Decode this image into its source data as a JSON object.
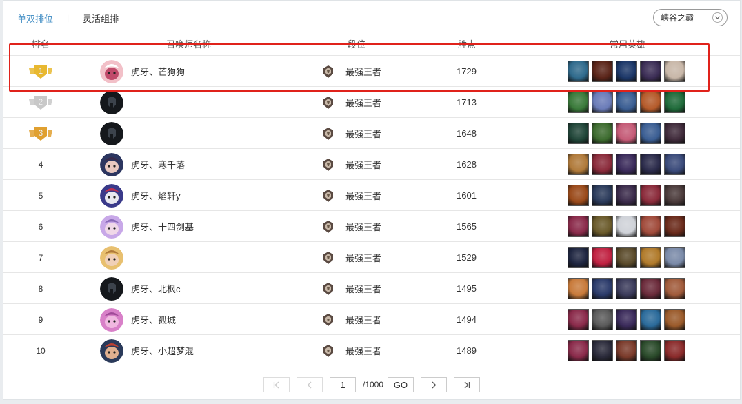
{
  "tabs": [
    {
      "label": "单双排位",
      "active": true
    },
    {
      "label": "灵活组排",
      "active": false
    }
  ],
  "region_select": {
    "value": "峡谷之巅"
  },
  "table": {
    "headers": {
      "rank": "排名",
      "name": "召唤师名称",
      "tier": "段位",
      "lp": "胜点",
      "heroes": "常用英雄"
    },
    "rows": [
      {
        "rank": "1",
        "medal": "gold",
        "name": "虎牙、芒狗狗",
        "avatar": "dog",
        "tier": "最强王者",
        "lp": "1729",
        "heroes": [
          "#2f6a8c",
          "#5a2418",
          "#1c3768",
          "#3b2d55",
          "#c8b7a8"
        ]
      },
      {
        "rank": "2",
        "medal": "silver",
        "name": "",
        "avatar": "dark",
        "tier": "最强王者",
        "lp": "1713",
        "heroes": [
          "#3a7a3a",
          "#6a7bb8",
          "#3a5d92",
          "#b45a2a",
          "#1f6b3a"
        ]
      },
      {
        "rank": "3",
        "medal": "bronze",
        "name": "",
        "avatar": "dark",
        "tier": "最强王者",
        "lp": "1648",
        "heroes": [
          "#204538",
          "#3c6b2e",
          "#c45a76",
          "#3a5d92",
          "#3f2a3a"
        ]
      },
      {
        "rank": "4",
        "medal": "",
        "name": "虎牙、寒千落",
        "avatar": "girl-blue",
        "tier": "最强王者",
        "lp": "1628",
        "heroes": [
          "#b07a3a",
          "#8a2a3a",
          "#3a2a5a",
          "#2a2a4a",
          "#3a4a7a"
        ]
      },
      {
        "rank": "5",
        "medal": "",
        "name": "虎牙、焰轩y",
        "avatar": "poro",
        "tier": "最强王者",
        "lp": "1601",
        "heroes": [
          "#9a4a1a",
          "#2a3a5a",
          "#3a2a4a",
          "#8a2a3a",
          "#4a3a3a"
        ]
      },
      {
        "rank": "6",
        "medal": "",
        "name": "虎牙、十四剑基",
        "avatar": "girl-purple",
        "tier": "最强王者",
        "lp": "1565",
        "heroes": [
          "#8a2a4a",
          "#6a5a2a",
          "#cfd2d8",
          "#a04a3a",
          "#6a2a1a"
        ]
      },
      {
        "rank": "7",
        "medal": "",
        "name": "",
        "avatar": "girl-blonde",
        "tier": "最强王者",
        "lp": "1529",
        "heroes": [
          "#1e2540",
          "#c02040",
          "#5a4a2a",
          "#b07a2a",
          "#7a8aa8"
        ]
      },
      {
        "rank": "8",
        "medal": "",
        "name": "虎牙、北枫c",
        "avatar": "dark",
        "tier": "最强王者",
        "lp": "1495",
        "heroes": [
          "#c87a3a",
          "#2a3a6a",
          "#3a3a5a",
          "#6a2a3a",
          "#a05a3a"
        ]
      },
      {
        "rank": "9",
        "medal": "",
        "name": "虎牙、孤城",
        "avatar": "pink",
        "tier": "最强王者",
        "lp": "1494",
        "heroes": [
          "#8a2a4a",
          "#5a5a5a",
          "#3a2a5a",
          "#2a6a9a",
          "#9a5a2a"
        ]
      },
      {
        "rank": "10",
        "medal": "",
        "name": "虎牙、小超梦混",
        "avatar": "boy-hat",
        "tier": "最强王者",
        "lp": "1489",
        "heroes": [
          "#8a2a4a",
          "#2a2a3a",
          "#7a3a2a",
          "#2a4a2a",
          "#8a2a2a"
        ]
      }
    ]
  },
  "pagination": {
    "current": "1",
    "total": "/1000",
    "go_label": "GO"
  },
  "colors": {
    "accent": "#4e95c8",
    "highlight": "#e0221b",
    "gold": "#e8b830",
    "silver": "#c8c8c8",
    "bronze": "#e0a030"
  }
}
